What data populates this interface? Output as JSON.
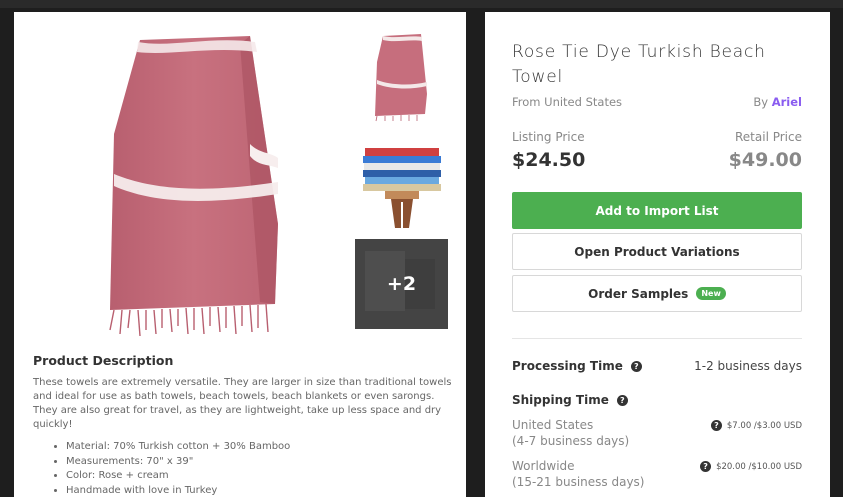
{
  "product": {
    "title": "Rose Tie Dye Turkish Beach Towel",
    "origin": "From United States",
    "by_label": "By",
    "seller": "Ariel",
    "more_images": "+2"
  },
  "pricing": {
    "listing_label": "Listing Price",
    "listing_price": "$24.50",
    "retail_label": "Retail Price",
    "retail_price": "$49.00"
  },
  "actions": {
    "add_import": "Add to Import List",
    "open_variations": "Open Product Variations",
    "order_samples": "Order Samples",
    "new_badge": "New"
  },
  "processing": {
    "label": "Processing Time",
    "value": "1-2 business days"
  },
  "shipping": {
    "label": "Shipping Time",
    "us_region": "United States",
    "us_days": "(4-7 business days)",
    "us_cost": "$7.00 /$3.00 USD",
    "ww_region": "Worldwide",
    "ww_days": "(15-21 business days)",
    "ww_cost": "$20.00 /$10.00 USD"
  },
  "description": {
    "title": "Product Description",
    "body": "These towels are extremely versatile. They are larger in size than traditional towels and ideal for use as bath towels, beach towels, beach blankets or even sarongs. They are also great for travel, as they are lightweight, take up less space and dry quickly!",
    "bullets": [
      "Material: 70% Turkish cotton + 30% Bamboo",
      "Measurements: 70\" x 39\"",
      "Color: Rose + cream",
      "Handmade with love in Turkey"
    ]
  },
  "colors": {
    "primary_green": "#4caf50",
    "seller_purple": "#8a5cf0",
    "towel_rose": "#c66e7d"
  },
  "icons": {
    "help": "question-circle-icon"
  }
}
